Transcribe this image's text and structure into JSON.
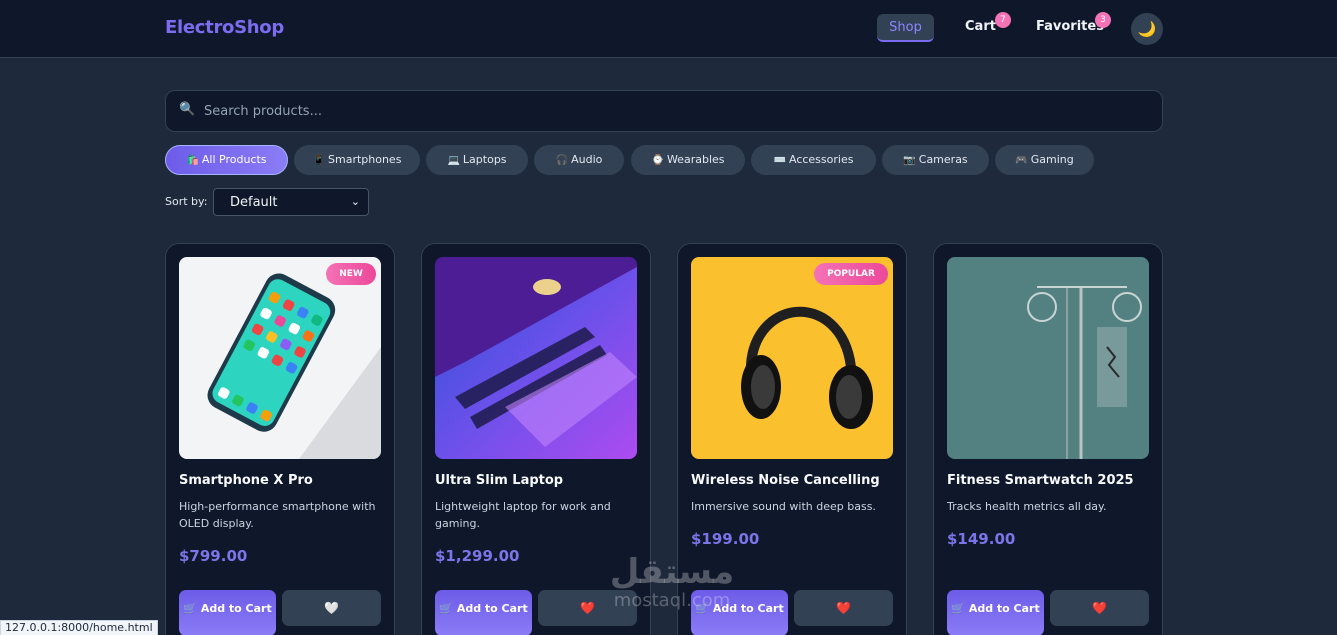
{
  "header": {
    "brand": "ElectroShop",
    "nav": {
      "shop": "Shop",
      "cart": "Cart",
      "favorites": "Favorites"
    },
    "cart_count": "7",
    "favorites_count": "3",
    "theme_icon": "🌙"
  },
  "search": {
    "icon": "🔍",
    "placeholder": "Search products..."
  },
  "categories": [
    {
      "icon": "🛍️",
      "label": "All Products",
      "active": true
    },
    {
      "icon": "📱",
      "label": "Smartphones"
    },
    {
      "icon": "💻",
      "label": "Laptops"
    },
    {
      "icon": "🎧",
      "label": "Audio"
    },
    {
      "icon": "⌚",
      "label": "Wearables"
    },
    {
      "icon": "⌨️",
      "label": "Accessories"
    },
    {
      "icon": "📷",
      "label": "Cameras"
    },
    {
      "icon": "🎮",
      "label": "Gaming"
    }
  ],
  "sort": {
    "label": "Sort by:",
    "value": "Default",
    "caret": "⌄"
  },
  "products": [
    {
      "title": "Smartphone X Pro",
      "description": "High-performance smartphone with OLED display.",
      "price": "$799.00",
      "badge": "NEW",
      "add_label": "Add to Cart",
      "cart_icon": "🛒",
      "fav_icon": "🤍"
    },
    {
      "title": "Ultra Slim Laptop",
      "description": "Lightweight laptop for work and gaming.",
      "price": "$1,299.00",
      "badge": "",
      "add_label": "Add to Cart",
      "cart_icon": "🛒",
      "fav_icon": "❤️"
    },
    {
      "title": "Wireless Noise Cancelling",
      "description": "Immersive sound with deep bass.",
      "price": "$199.00",
      "badge": "POPULAR",
      "add_label": "Add to Cart",
      "cart_icon": "🛒",
      "fav_icon": "❤️"
    },
    {
      "title": "Fitness Smartwatch 2025",
      "description": "Tracks health metrics all day.",
      "price": "$149.00",
      "badge": "",
      "add_label": "Add to Cart",
      "cart_icon": "🛒",
      "fav_icon": "❤️"
    }
  ],
  "watermark": {
    "arabic": "مستقل",
    "latin": "mostaql.com"
  },
  "status_url": "127.0.0.1:8000/home.html",
  "colors": {
    "accent": "#7c6cf0",
    "badge": "#f472b6",
    "background": "#1e293b",
    "surface": "#0f172a"
  }
}
